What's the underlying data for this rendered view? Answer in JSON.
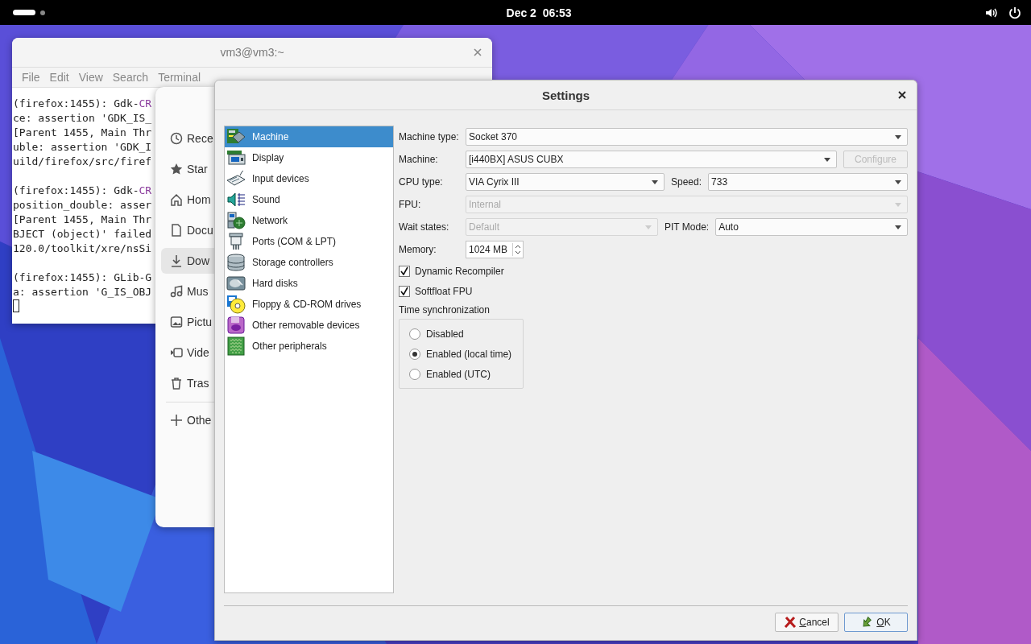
{
  "top_bar": {
    "clock": "Dec 2  06:53"
  },
  "terminal": {
    "title": "vm3@vm3:~",
    "menu": [
      "File",
      "Edit",
      "View",
      "Search",
      "Terminal"
    ],
    "blocks": [
      [
        "(firefox:1455): Gdk-**CR**",
        "ce: assertion 'GDK_IS_",
        "[Parent 1455, Main Thr",
        "uble: assertion 'GDK_I",
        "uild/firefox/src/firef"
      ],
      [
        "(firefox:1455): Gdk-**CR**",
        "position_double: asser",
        "[Parent 1455, Main Thr",
        "BJECT (object)' failed",
        "120.0/toolkit/xre/nsSi"
      ],
      [
        "(firefox:1455): GLib-G",
        "a: assertion 'G_IS_OBJ"
      ]
    ]
  },
  "files": {
    "sidebar": [
      {
        "label": "Rece",
        "selected": false
      },
      {
        "label": "Star",
        "selected": false
      },
      {
        "label": "Hom",
        "selected": false
      },
      {
        "label": "Docu",
        "selected": false
      },
      {
        "label": "Dow",
        "selected": true
      },
      {
        "label": "Mus",
        "selected": false
      },
      {
        "label": "Pictu",
        "selected": false
      },
      {
        "label": "Vide",
        "selected": false
      },
      {
        "label": "Tras",
        "selected": false
      },
      {
        "label": "Othe",
        "selected": false
      }
    ]
  },
  "settings": {
    "title": "Settings",
    "categories": [
      {
        "label": "Machine",
        "selected": true
      },
      {
        "label": "Display",
        "selected": false
      },
      {
        "label": "Input devices",
        "selected": false
      },
      {
        "label": "Sound",
        "selected": false
      },
      {
        "label": "Network",
        "selected": false
      },
      {
        "label": "Ports (COM & LPT)",
        "selected": false
      },
      {
        "label": "Storage controllers",
        "selected": false
      },
      {
        "label": "Hard disks",
        "selected": false
      },
      {
        "label": "Floppy & CD-ROM drives",
        "selected": false
      },
      {
        "label": "Other removable devices",
        "selected": false
      },
      {
        "label": "Other peripherals",
        "selected": false
      }
    ],
    "rows": [
      [
        {
          "kind": "select",
          "label": "Machine type:",
          "value": "Socket 370",
          "disabled": false
        }
      ],
      [
        {
          "kind": "select",
          "label": "Machine:",
          "value": "[i440BX] ASUS CUBX",
          "disabled": false
        },
        {
          "kind": "button",
          "value": "Configure",
          "disabled": true
        }
      ],
      [
        {
          "kind": "select",
          "label": "CPU type:",
          "value": "VIA Cyrix III",
          "disabled": false
        },
        {
          "kind": "select",
          "label": "Speed:",
          "value": "733",
          "disabled": false
        }
      ],
      [
        {
          "kind": "select",
          "label": "FPU:",
          "value": "Internal",
          "disabled": true
        }
      ],
      [
        {
          "kind": "select",
          "label": "Wait states:",
          "value": "Default",
          "disabled": true
        },
        {
          "kind": "select",
          "label": "PIT Mode:",
          "value": "Auto",
          "disabled": false
        }
      ],
      [
        {
          "kind": "spin",
          "label": "Memory:",
          "value": "1024 MB",
          "disabled": false
        }
      ]
    ],
    "checkboxes": [
      {
        "label": "Dynamic Recompiler",
        "checked": true
      },
      {
        "label": "Softfloat FPU",
        "checked": true
      }
    ],
    "time_sync": {
      "label": "Time synchronization",
      "options": [
        {
          "label": "Disabled",
          "selected": false
        },
        {
          "label": "Enabled (local time)",
          "selected": true
        },
        {
          "label": "Enabled (UTC)",
          "selected": false
        }
      ]
    },
    "buttons": [
      {
        "label": "Cancel",
        "default": false
      },
      {
        "label": "OK",
        "default": true
      }
    ]
  }
}
